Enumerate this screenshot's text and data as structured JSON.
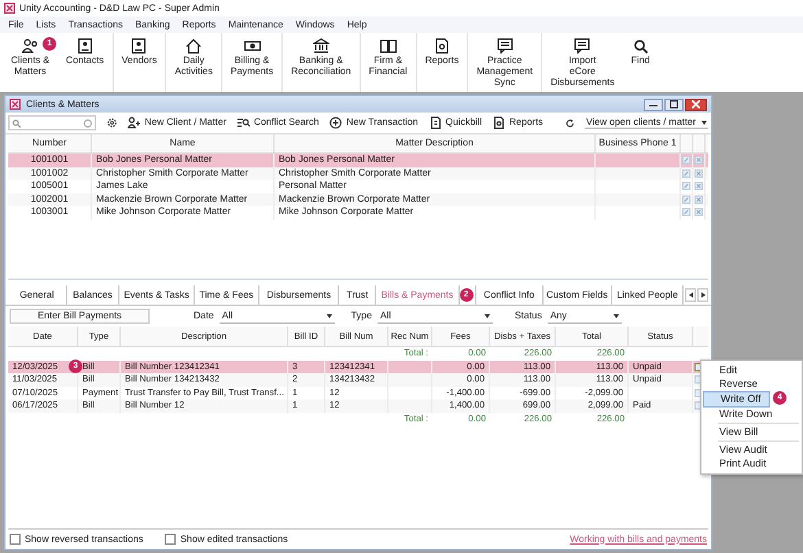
{
  "app_title": "Unity Accounting - D&D Law PC - Super Admin",
  "menu": [
    "File",
    "Lists",
    "Transactions",
    "Banking",
    "Reports",
    "Maintenance",
    "Windows",
    "Help"
  ],
  "toolbar": [
    {
      "lines": [
        "Clients &",
        "Matters"
      ],
      "badge": "1"
    },
    {
      "lines": [
        "Contacts"
      ]
    },
    {
      "lines": [
        "Vendors"
      ]
    },
    {
      "lines": [
        "Daily",
        "Activities"
      ]
    },
    {
      "lines": [
        "Billing &",
        "Payments"
      ]
    },
    {
      "lines": [
        "Banking &",
        "Reconciliation"
      ]
    },
    {
      "lines": [
        "Firm &",
        "Financial"
      ]
    },
    {
      "lines": [
        "Reports"
      ]
    },
    {
      "lines": [
        "Practice",
        "Management",
        "Sync"
      ]
    },
    {
      "lines": [
        "Import",
        "eCore",
        "Disbursements"
      ]
    },
    {
      "lines": [
        "Find"
      ]
    }
  ],
  "window": {
    "title": "Clients & Matters",
    "actions": [
      "New Client / Matter",
      "Conflict Search",
      "New Transaction",
      "Quickbill",
      "Reports"
    ],
    "view_filter": "View open clients / matter",
    "clients": {
      "columns": [
        "Number",
        "Name",
        "Matter Description",
        "Business Phone 1"
      ],
      "rows": [
        {
          "cells": [
            "1001001",
            "Bob Jones Personal Matter",
            "Bob Jones Personal Matter",
            ""
          ],
          "selected": true
        },
        {
          "cells": [
            "1001002",
            "Christopher Smith Corporate Matter",
            "Christopher Smith Corporate Matter",
            ""
          ],
          "selected": false
        },
        {
          "cells": [
            "1005001",
            "James Lake",
            "Personal Matter",
            ""
          ],
          "selected": false
        },
        {
          "cells": [
            "1002001",
            "Mackenzie Brown Corporate Matter",
            "Mackenzie Brown Corporate Matter",
            ""
          ],
          "selected": false
        },
        {
          "cells": [
            "1003001",
            "Mike Johnson Corporate Matter",
            "Mike Johnson Corporate Matter",
            ""
          ],
          "selected": false
        }
      ]
    },
    "tabs": [
      {
        "label": "General",
        "selected": false
      },
      {
        "label": "Balances",
        "selected": false
      },
      {
        "label": "Events & Tasks",
        "selected": false
      },
      {
        "label": "Time & Fees",
        "selected": false
      },
      {
        "label": "Disbursements",
        "selected": false
      },
      {
        "label": "Trust",
        "selected": false
      },
      {
        "label": "Bills & Payments",
        "selected": true,
        "badge": "2"
      },
      {
        "label": "Conflict Info",
        "selected": false
      },
      {
        "label": "Custom Fields",
        "selected": false
      },
      {
        "label": "Linked People",
        "selected": false
      }
    ],
    "enter_button": "Enter Bill Payments",
    "filters": [
      {
        "label": "Date",
        "value": "All"
      },
      {
        "label": "Type",
        "value": "All"
      },
      {
        "label": "Status",
        "value": "Any"
      }
    ],
    "bills": {
      "columns": [
        "Date",
        "Type",
        "Description",
        "Bill ID",
        "Bill Num",
        "Rec Num",
        "Fees",
        "Disbs + Taxes",
        "Total",
        "Status"
      ],
      "top_total": {
        "label": "Total :",
        "fees": "0.00",
        "disbs": "226.00",
        "total": "226.00"
      },
      "rows": [
        {
          "cells": [
            "12/03/2025",
            "Bill",
            "Bill Number 123412341",
            "3",
            "123412341",
            "",
            "0.00",
            "113.00",
            "113.00",
            "Unpaid"
          ],
          "selected": true,
          "badge": "3"
        },
        {
          "cells": [
            "11/03/2025",
            "Bill",
            "Bill Number 134213432",
            "2",
            "134213432",
            "",
            "0.00",
            "113.00",
            "113.00",
            "Unpaid"
          ],
          "selected": false
        },
        {
          "cells": [
            "07/10/2025",
            "Payment",
            "Trust Transfer to Pay Bill, Trust Transf...",
            "1",
            "12",
            "",
            "-1,400.00",
            "-699.00",
            "-2,099.00",
            ""
          ],
          "selected": false
        },
        {
          "cells": [
            "06/17/2025",
            "Bill",
            "Bill Number 12",
            "1",
            "12",
            "",
            "1,400.00",
            "699.00",
            "2,099.00",
            "Paid"
          ],
          "selected": false
        }
      ],
      "bottom_total": {
        "label": "Total :",
        "fees": "0.00",
        "disbs": "226.00",
        "total": "226.00"
      }
    },
    "options": [
      {
        "label": "Show reversed transactions",
        "checked": false
      },
      {
        "label": "Show edited transactions",
        "checked": false
      }
    ],
    "help_link": "Working with bills and payments"
  },
  "context_menu": [
    [
      {
        "label": "Edit",
        "selected": false
      },
      {
        "label": "Reverse",
        "selected": false
      },
      {
        "label": "Write Off",
        "selected": true,
        "badge": "4"
      },
      {
        "label": "Write Down",
        "selected": false
      }
    ],
    [
      {
        "label": "View Bill",
        "selected": false
      }
    ],
    [
      {
        "label": "View Audit",
        "selected": false
      },
      {
        "label": "Print Audit",
        "selected": false
      }
    ]
  ]
}
